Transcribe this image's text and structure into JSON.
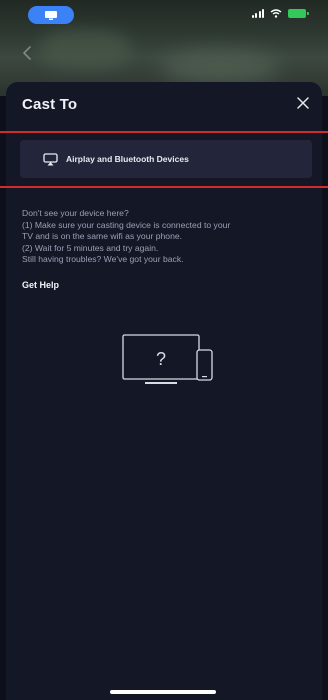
{
  "status_bar": {
    "cast_icon": "screen-mirroring-icon",
    "signal_icon": "cellular-signal-icon",
    "wifi_icon": "wifi-icon",
    "battery_icon": "battery-charging-icon",
    "cast_pill_color": "#3b82f6",
    "battery_color": "#34c759"
  },
  "background": {
    "back_icon": "chevron-left-icon"
  },
  "sheet": {
    "title": "Cast To",
    "close_icon": "close-icon",
    "device_option": {
      "icon": "airplay-icon",
      "label": "Airplay and Bluetooth Devices"
    },
    "help_lines": [
      "Don't see your device here?",
      "(1) Make sure your casting device is connected to your",
      "TV and is on the same wifi as your phone.",
      "(2) Wait for 5 minutes and try again.",
      "Still having troubles? We've got your back."
    ],
    "get_help_label": "Get Help",
    "illustration": {
      "icon": "tv-and-phone-unknown-icon",
      "symbol": "?"
    }
  },
  "annotation": {
    "highlight_color": "#d32b2b"
  }
}
